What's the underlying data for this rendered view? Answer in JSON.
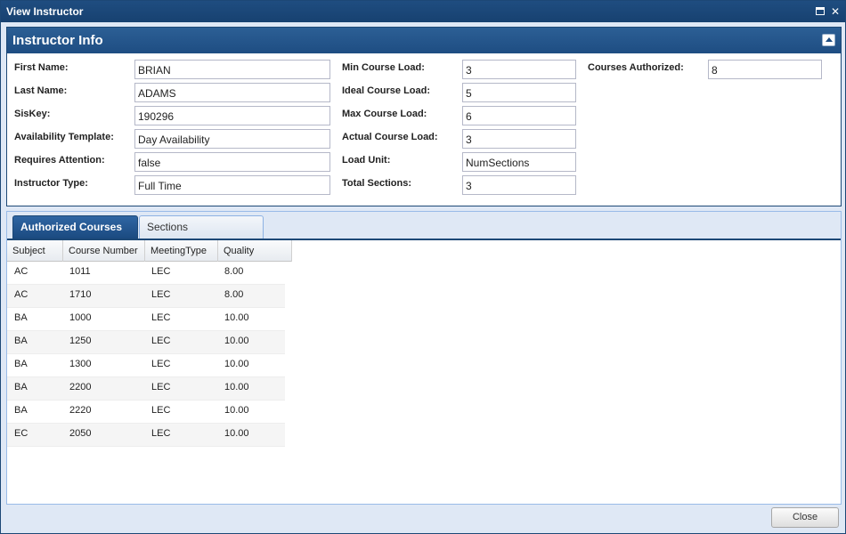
{
  "window": {
    "title": "View Instructor",
    "maximize_icon": "maximize-icon",
    "close_icon": "close-icon",
    "close_glyph": "✕"
  },
  "panel": {
    "title": "Instructor Info",
    "collapse_icon": "collapse-up-icon"
  },
  "fields": {
    "first_name": {
      "label": "First Name:",
      "value": "BRIAN"
    },
    "last_name": {
      "label": "Last Name:",
      "value": "ADAMS"
    },
    "siskey": {
      "label": "SisKey:",
      "value": "190296"
    },
    "availability_template": {
      "label": "Availability Template:",
      "value": "Day Availability"
    },
    "requires_attention": {
      "label": "Requires Attention:",
      "value": "false"
    },
    "instructor_type": {
      "label": "Instructor Type:",
      "value": "Full Time"
    },
    "min_course_load": {
      "label": "Min Course Load:",
      "value": "3"
    },
    "ideal_course_load": {
      "label": "Ideal Course Load:",
      "value": "5"
    },
    "max_course_load": {
      "label": "Max Course Load:",
      "value": "6"
    },
    "actual_course_load": {
      "label": "Actual Course Load:",
      "value": "3"
    },
    "load_unit": {
      "label": "Load Unit:",
      "value": "NumSections"
    },
    "total_sections": {
      "label": "Total Sections:",
      "value": "3"
    },
    "courses_authorized": {
      "label": "Courses Authorized:",
      "value": "8"
    }
  },
  "tabs": [
    {
      "label": "Authorized Courses",
      "active": true
    },
    {
      "label": "Sections",
      "active": false
    }
  ],
  "grid": {
    "columns": [
      "Subject",
      "Course Number",
      "MeetingType",
      "Quality"
    ],
    "rows": [
      [
        "AC",
        "1011",
        "LEC",
        "8.00"
      ],
      [
        "AC",
        "1710",
        "LEC",
        "8.00"
      ],
      [
        "BA",
        "1000",
        "LEC",
        "10.00"
      ],
      [
        "BA",
        "1250",
        "LEC",
        "10.00"
      ],
      [
        "BA",
        "1300",
        "LEC",
        "10.00"
      ],
      [
        "BA",
        "2200",
        "LEC",
        "10.00"
      ],
      [
        "BA",
        "2220",
        "LEC",
        "10.00"
      ],
      [
        "EC",
        "2050",
        "LEC",
        "10.00"
      ]
    ]
  },
  "footer": {
    "close_label": "Close"
  }
}
